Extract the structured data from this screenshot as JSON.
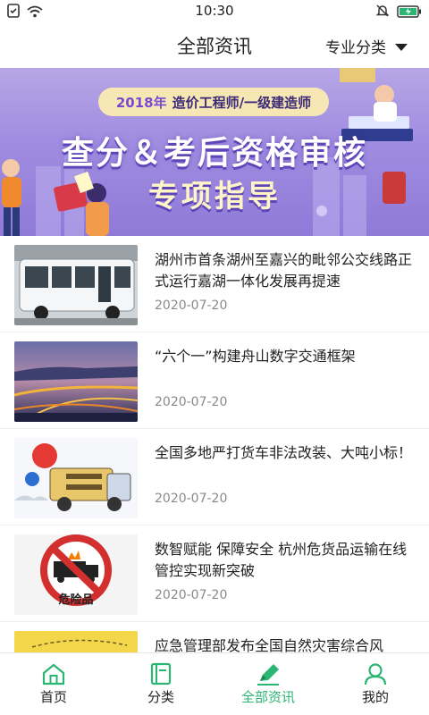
{
  "status_bar": {
    "time": "10:30"
  },
  "header": {
    "title": "全部资讯",
    "category_label": "专业分类"
  },
  "banner": {
    "pill_year": "2018年",
    "pill_text": "造价工程师/一级建造师",
    "line1": "查分＆考后资格审核",
    "line2": "专项指导"
  },
  "news": [
    {
      "title": "湖州市首条湖州至嘉兴的毗邻公交线路正式运行嘉湖一体化发展再提速",
      "date": "2020-07-20",
      "thumb": "bus-photo"
    },
    {
      "title": "“六个一”构建舟山数字交通框架",
      "date": "2020-07-20",
      "thumb": "bridge-night-photo"
    },
    {
      "title": "全国多地严打货车非法改装、大吨小标！",
      "date": "2020-07-20",
      "thumb": "truck-cartoon"
    },
    {
      "title": "数智赋能 保障安全 杭州危货品运输在线管控实现新突破",
      "date": "2020-07-20",
      "thumb": "hazmat-sign",
      "thumb_text": "危险品"
    },
    {
      "title": "应急管理部发布全国自然灾害综合风",
      "date": "",
      "thumb": "newspaper-photo"
    }
  ],
  "tabs": [
    {
      "label": "首页",
      "icon": "home-icon",
      "active": false
    },
    {
      "label": "分类",
      "icon": "book-icon",
      "active": false
    },
    {
      "label": "全部资讯",
      "icon": "pencil-icon",
      "active": true
    },
    {
      "label": "我的",
      "icon": "user-icon",
      "active": false
    }
  ],
  "colors": {
    "accent": "#2bb673",
    "banner": "#a08ce0",
    "date": "#8a8a8a"
  }
}
